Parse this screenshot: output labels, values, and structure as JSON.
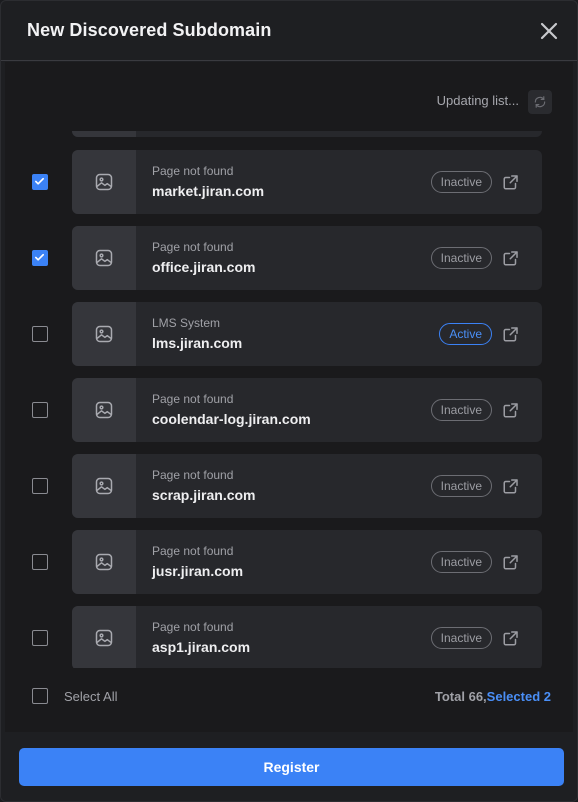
{
  "header": {
    "title": "New Discovered Subdomain"
  },
  "status": {
    "updating_text": "Updating list..."
  },
  "items": [
    {
      "checked": true,
      "subtitle": "Page not found",
      "domain": "market.jiran.com",
      "status": "Inactive"
    },
    {
      "checked": true,
      "subtitle": "Page not found",
      "domain": "office.jiran.com",
      "status": "Inactive"
    },
    {
      "checked": false,
      "subtitle": "LMS System",
      "domain": "lms.jiran.com",
      "status": "Active"
    },
    {
      "checked": false,
      "subtitle": "Page not found",
      "domain": "coolendar-log.jiran.com",
      "status": "Inactive"
    },
    {
      "checked": false,
      "subtitle": "Page not found",
      "domain": "scrap.jiran.com",
      "status": "Inactive"
    },
    {
      "checked": false,
      "subtitle": "Page not found",
      "domain": "jusr.jiran.com",
      "status": "Inactive"
    },
    {
      "checked": false,
      "subtitle": "Page not found",
      "domain": "asp1.jiran.com",
      "status": "Inactive"
    }
  ],
  "footer": {
    "select_all_label": "Select All",
    "total_label": "Total 66,",
    "selected_label": "Selected 2"
  },
  "actions": {
    "register_label": "Register"
  },
  "colors": {
    "accent": "#3b82f6",
    "card": "#27282c",
    "background": "#1e1f22"
  },
  "icons": {
    "close": "close-icon",
    "refresh": "refresh-icon",
    "thumbnail": "image-placeholder-icon",
    "open": "external-link-icon",
    "check": "check-icon"
  }
}
